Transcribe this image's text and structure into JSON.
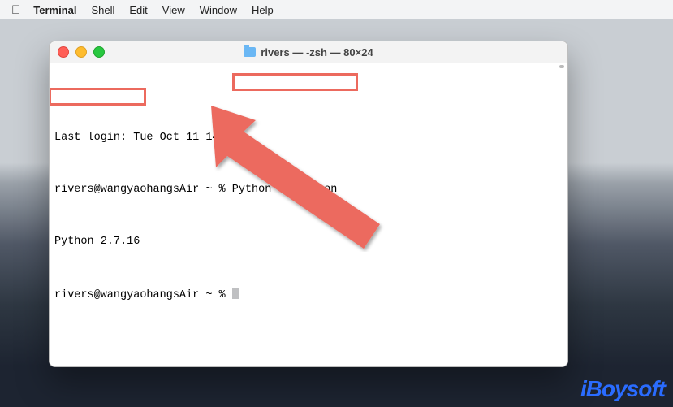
{
  "menubar": {
    "app": "Terminal",
    "items": [
      "Shell",
      "Edit",
      "View",
      "Window",
      "Help"
    ]
  },
  "window": {
    "title": "rivers — -zsh — 80×24"
  },
  "terminal": {
    "line1_a": "Last login: Tue Oct 11 14:",
    "line1_b": "",
    "line2_a": "rivers@wangyaohangsAir ~ % ",
    "line2_cmd": "Python --version",
    "line3_result": "Python 2.7.16",
    "line4_prompt": "rivers@wangyaohangsAir ~ % "
  },
  "annotation": {
    "highlight_color": "#ec6a5e"
  },
  "watermark": "iBoysoft"
}
